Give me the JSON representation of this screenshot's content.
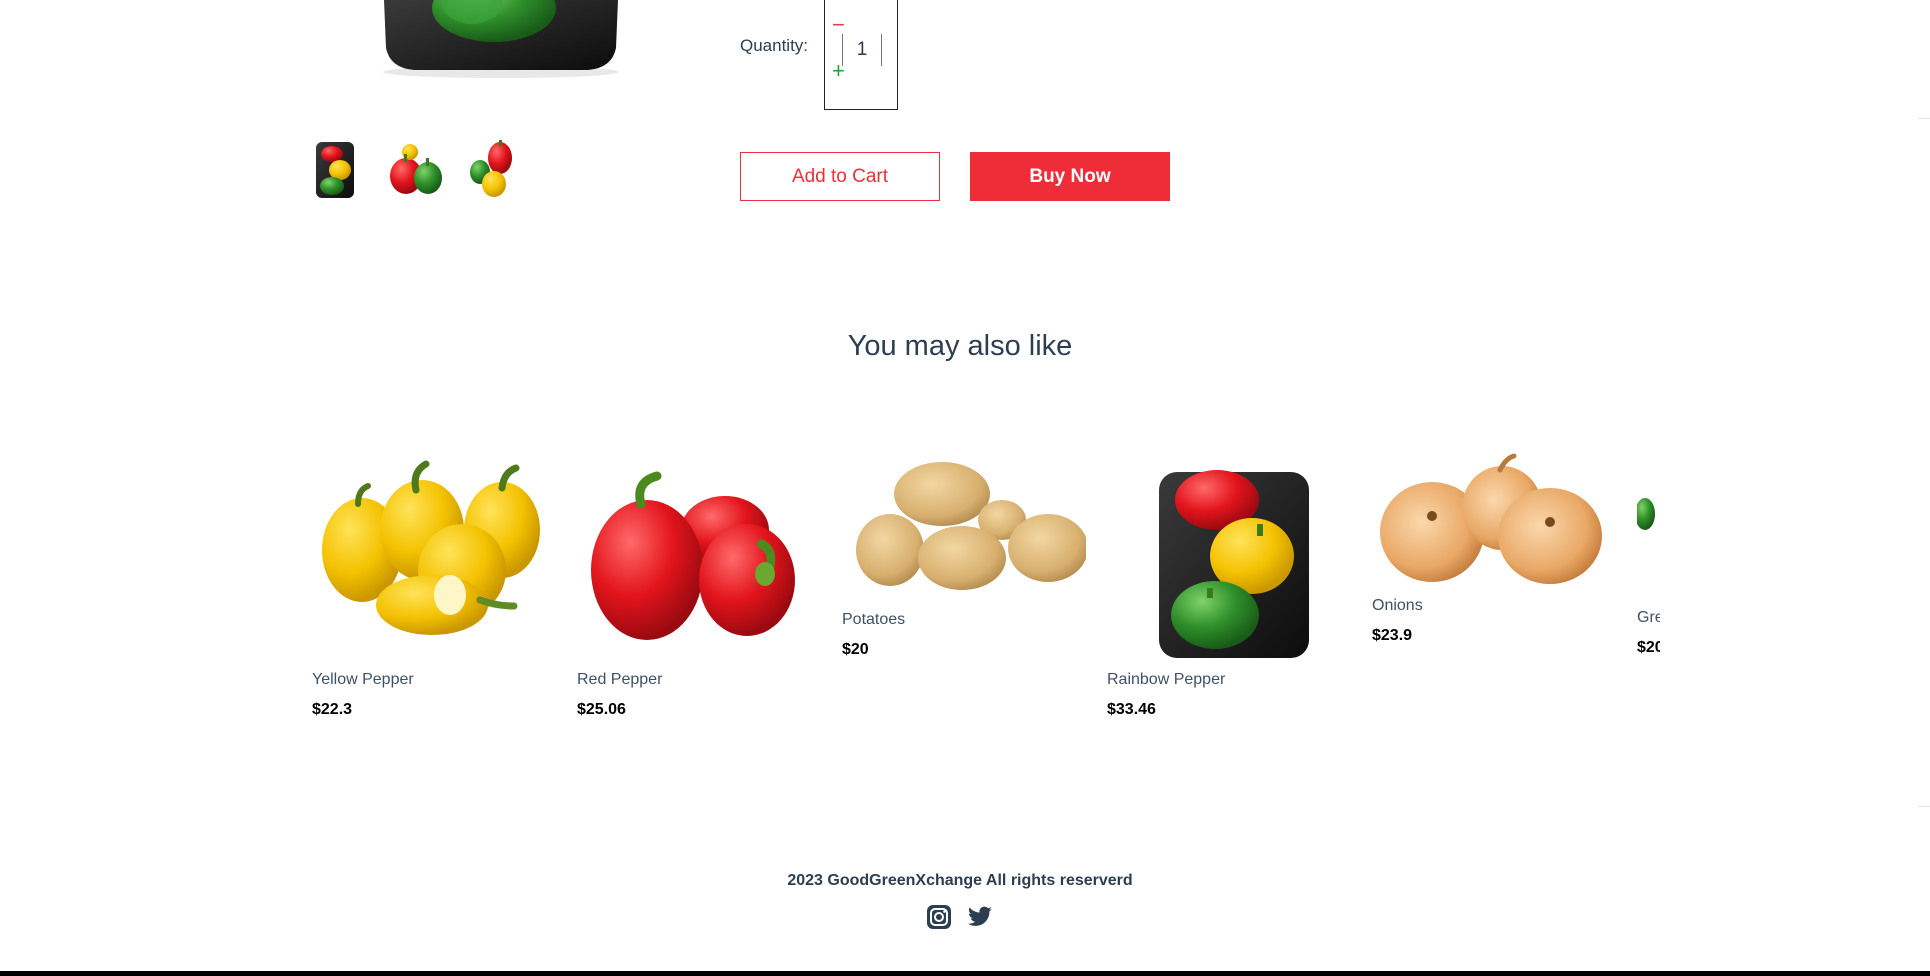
{
  "product": {
    "main_image": "rainbow-pepper-tray",
    "thumbnails": [
      "rainbow-pepper-tray",
      "red-and-green-peppers",
      "red-and-yellow-peppers"
    ],
    "quantity": {
      "label": "Quantity:",
      "value": "1",
      "decrement_symbol": "−",
      "increment_symbol": "+"
    },
    "add_to_cart_label": "Add to Cart",
    "buy_now_label": "Buy Now"
  },
  "recommendations": {
    "title": "You may also like",
    "items": [
      {
        "name": "Yellow Pepper",
        "price": "$22.3",
        "image": "yellow-pepper"
      },
      {
        "name": "Red Pepper",
        "price": "$25.06",
        "image": "red-pepper"
      },
      {
        "name": "Potatoes",
        "price": "$20",
        "image": "potatoes"
      },
      {
        "name": "Rainbow Pepper",
        "price": "$33.46",
        "image": "rainbow-pepper-tray"
      },
      {
        "name": "Onions",
        "price": "$23.9",
        "image": "onions"
      },
      {
        "name": "Gre",
        "price": "$20",
        "image": "green-produce-cropped"
      }
    ]
  },
  "footer": {
    "copyright": "2023 GoodGreenXchange All rights reserverd",
    "social": [
      "instagram-icon",
      "twitter-icon"
    ]
  },
  "colors": {
    "accent_red": "#ef2d38",
    "text_dark": "#2d3e50",
    "plus_green": "#1ea62f"
  }
}
